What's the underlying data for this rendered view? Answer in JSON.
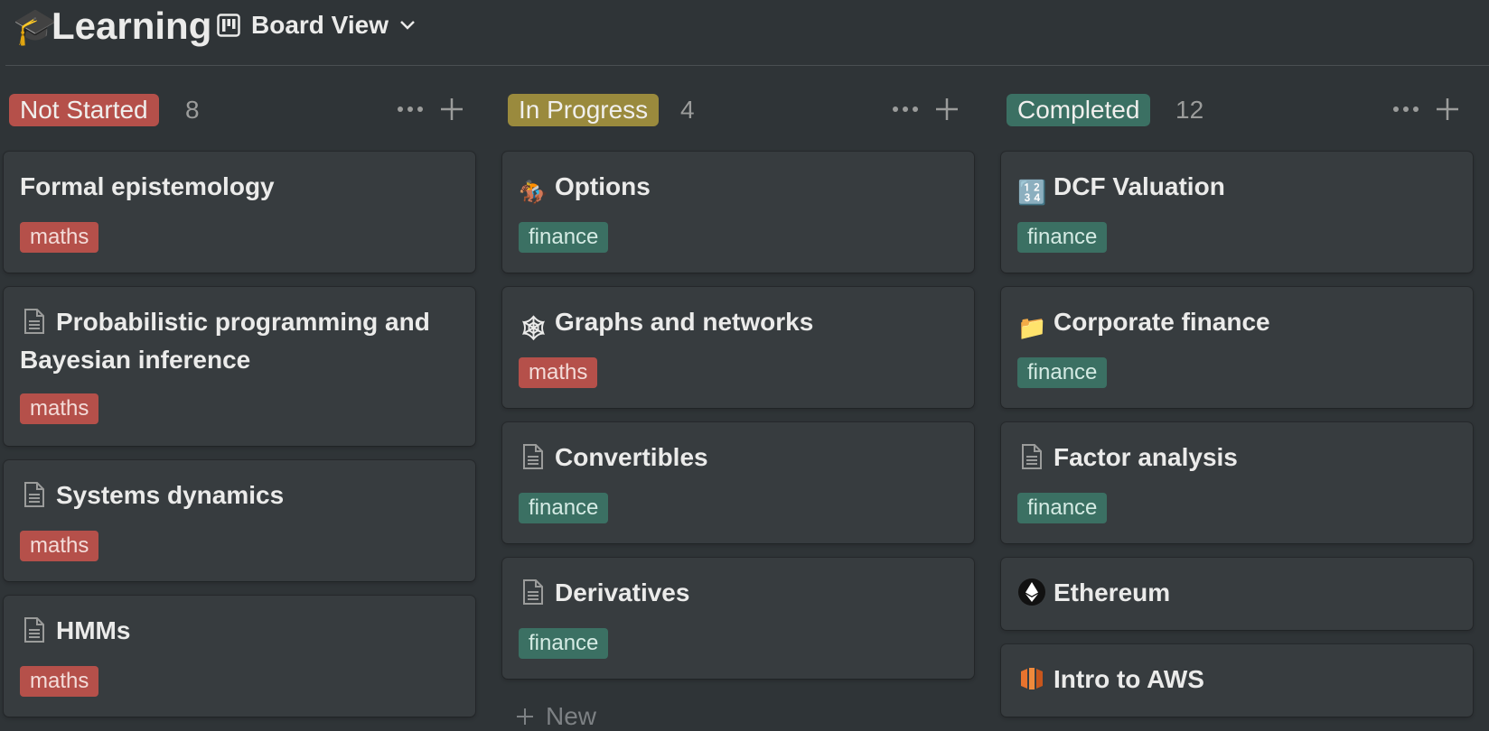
{
  "page": {
    "icon": "🎓",
    "title": "Learning"
  },
  "view": {
    "icon": "board-view-icon",
    "label": "Board View",
    "chevron": "chevron-down-icon"
  },
  "colors": {
    "maths": "#b5504a",
    "finance": "#3b7063",
    "not_started": "#b5504a",
    "in_progress": "#9a8a3d",
    "completed": "#3b7063"
  },
  "columns": [
    {
      "status": "Not Started",
      "count": "8",
      "cards": [
        {
          "title": "Formal epistemology",
          "icon": "",
          "tag": "maths"
        },
        {
          "title": "Probabilistic programming and Bayesian inference",
          "icon": "document-icon",
          "tag": "maths"
        },
        {
          "title": "Systems dynamics",
          "icon": "document-icon",
          "tag": "maths"
        },
        {
          "title": "HMMs",
          "icon": "document-icon",
          "tag": "maths"
        }
      ]
    },
    {
      "status": "In Progress",
      "count": "4",
      "cards": [
        {
          "title": "Options",
          "icon": "🏇",
          "tag": "finance"
        },
        {
          "title": "Graphs and networks",
          "icon": "🕸",
          "tag": "maths"
        },
        {
          "title": "Convertibles",
          "icon": "document-icon",
          "tag": "finance"
        },
        {
          "title": "Derivatives",
          "icon": "document-icon",
          "tag": "finance"
        }
      ],
      "new_label": "New"
    },
    {
      "status": "Completed",
      "count": "12",
      "cards": [
        {
          "title": "DCF Valuation",
          "icon": "🔢",
          "tag": "finance"
        },
        {
          "title": "Corporate finance",
          "icon": "📁",
          "tag": "finance"
        },
        {
          "title": "Factor analysis",
          "icon": "document-icon",
          "tag": "finance"
        },
        {
          "title": "Ethereum",
          "icon": "ethereum-icon",
          "tag": ""
        },
        {
          "title": "Intro to AWS",
          "icon": "aws-icon",
          "tag": ""
        }
      ]
    }
  ]
}
